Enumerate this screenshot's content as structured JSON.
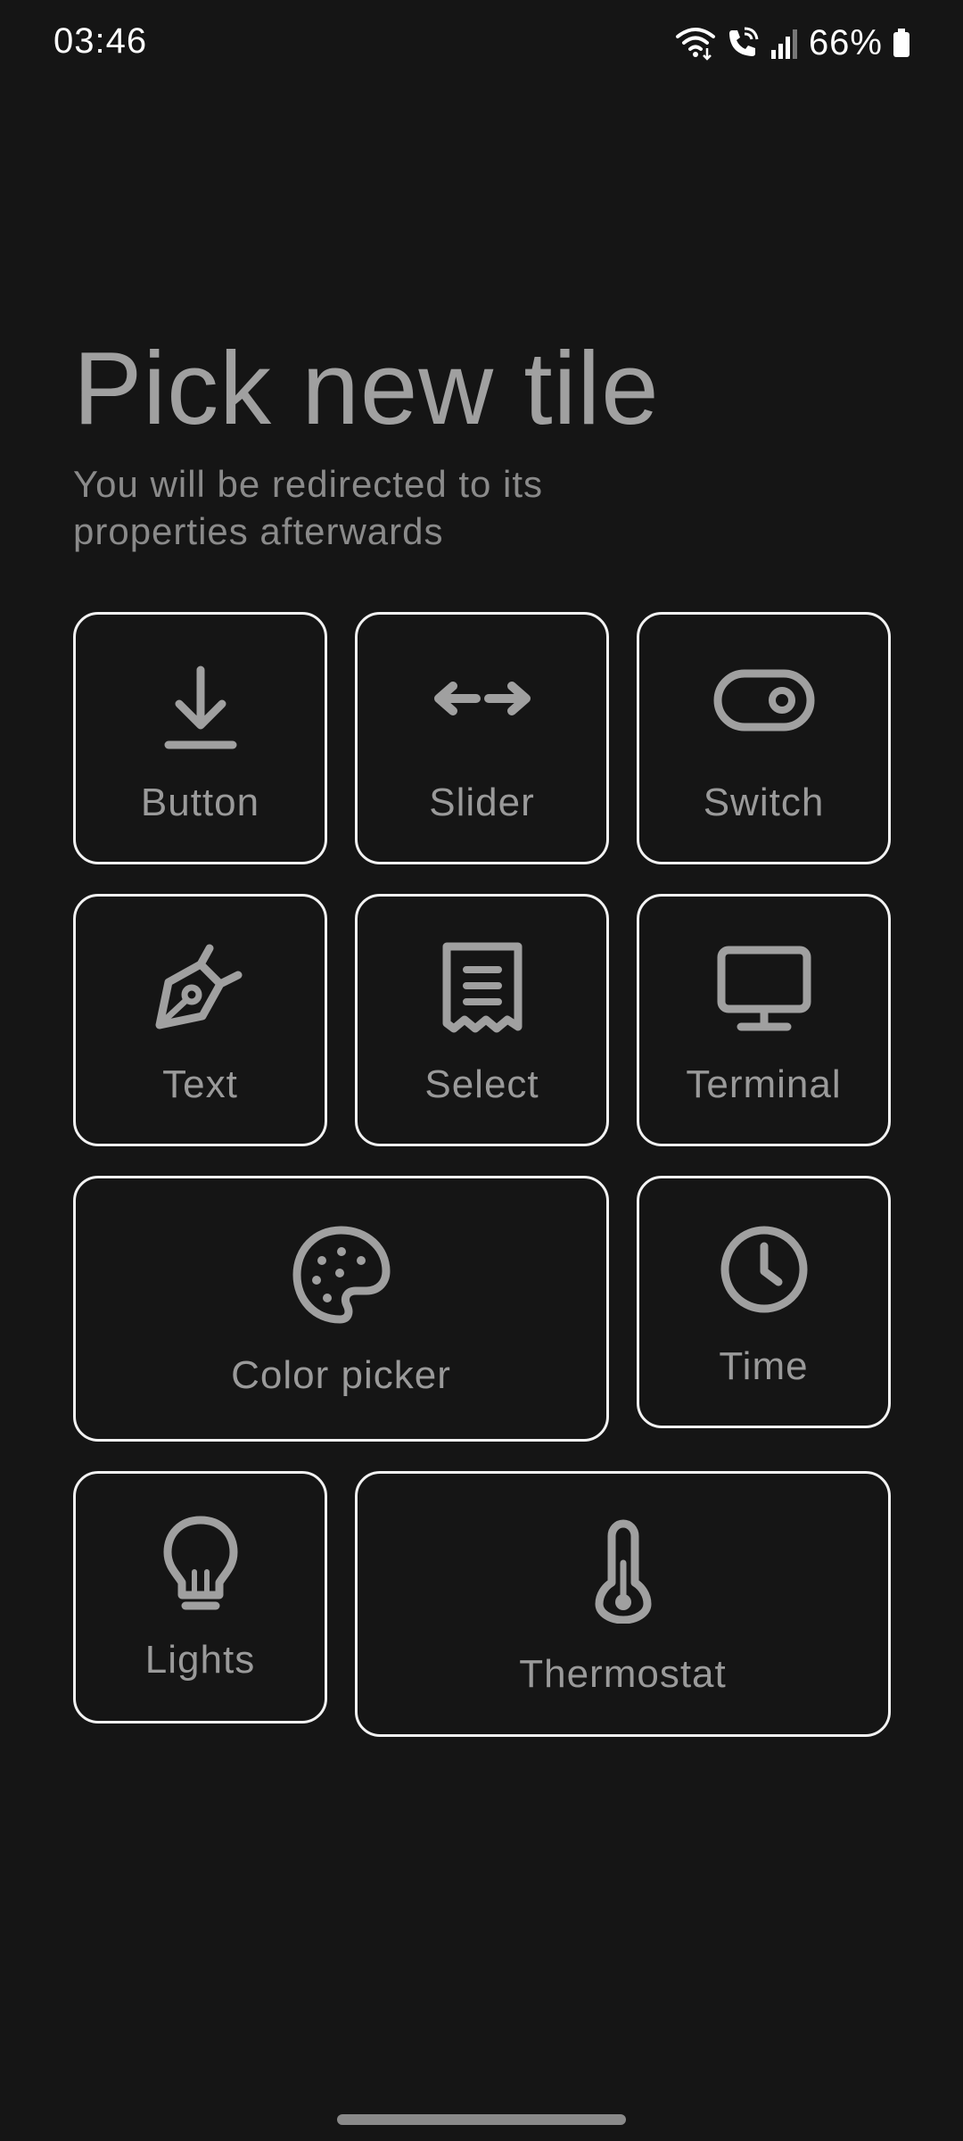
{
  "status_bar": {
    "time": "03:46",
    "battery": "66%",
    "icons": [
      "wifi-icon",
      "wifi-calling-icon",
      "signal-icon",
      "battery-icon"
    ]
  },
  "header": {
    "title": "Pick new tile",
    "subtitle": "You will be redirected to its properties afterwards"
  },
  "tiles": [
    {
      "label": "Button",
      "icon": "download-icon"
    },
    {
      "label": "Slider",
      "icon": "arrows-horizontal-icon"
    },
    {
      "label": "Switch",
      "icon": "toggle-icon"
    },
    {
      "label": "Text",
      "icon": "pen-nib-icon"
    },
    {
      "label": "Select",
      "icon": "receipt-icon"
    },
    {
      "label": "Terminal",
      "icon": "monitor-icon"
    },
    {
      "label": "Color picker",
      "icon": "palette-icon"
    },
    {
      "label": "Time",
      "icon": "clock-icon"
    },
    {
      "label": "Lights",
      "icon": "lightbulb-icon"
    },
    {
      "label": "Thermostat",
      "icon": "thermometer-icon"
    }
  ],
  "colors": {
    "background": "#151515",
    "tile_border": "#f2f2f2",
    "icon": "#a0a0a0",
    "text": "#9a9a9a",
    "status_text": "#ffffff"
  }
}
